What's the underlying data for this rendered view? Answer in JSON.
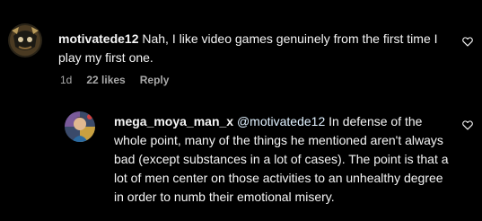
{
  "comments": [
    {
      "username": "motivatede12",
      "text": "Nah, I like video games genuinely from the first time I play my first one.",
      "time": "1d",
      "likes": "22 likes",
      "reply": "Reply",
      "icons": {
        "like": "heart-icon",
        "avatar": "avatar-image"
      }
    },
    {
      "username": "mega_moya_man_x",
      "mention": "@motivatede12",
      "text": "In defense of the whole point, many of the things he mentioned aren't always bad (except substances in a lot of cases). The point is that a lot of men center on those activities to an unhealthy degree in order to numb their emotional misery.",
      "icons": {
        "like": "heart-icon",
        "avatar": "avatar-image"
      }
    }
  ],
  "colors": {
    "background": "#000000",
    "text": "#f5f5f5",
    "meta": "#a8a8a8",
    "mention": "#e0f1ff"
  }
}
